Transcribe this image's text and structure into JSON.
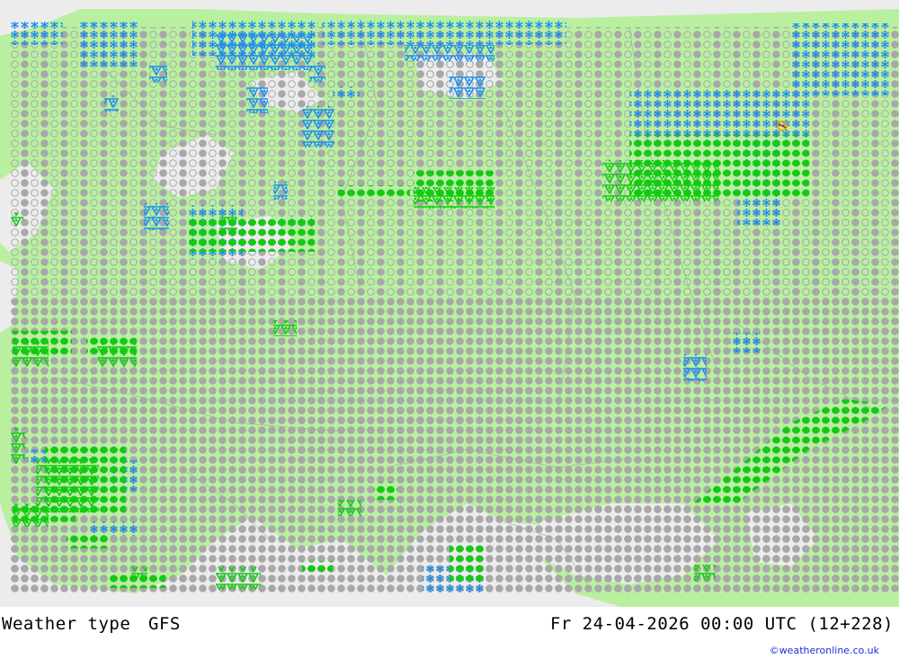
{
  "footer": {
    "title": "Weather type",
    "model": "GFS",
    "valid_time": "Fr 24-04-2026 00:00 UTC (12+228)",
    "credit": "©weatheronline.co.uk"
  },
  "legend_colors": {
    "land": "#b8f0a0",
    "sea": "#ececec",
    "cloud_symbol": "#a8a8a8",
    "rain": "#10cc10",
    "snow": "#1890f0",
    "shower": "#10cc10"
  },
  "icons": [
    "overcast-circle-icon",
    "partly-cloudy-circle-icon",
    "rain-dot-icon",
    "snow-star-icon",
    "rain-shower-icon",
    "snow-shower-icon",
    "thunderstorm-icon"
  ]
}
